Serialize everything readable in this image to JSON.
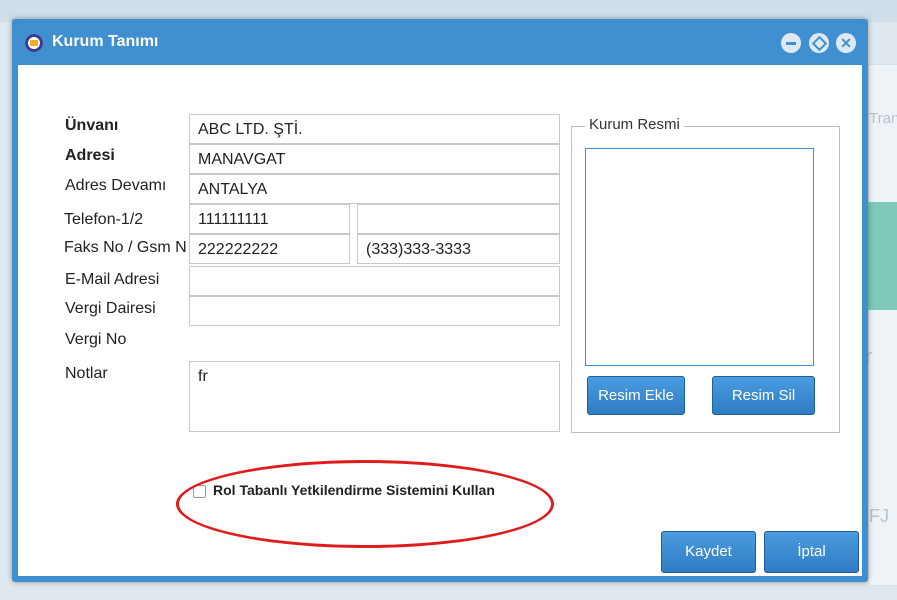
{
  "background": {
    "fragment_tran": "Tran",
    "fragment_fj": "FJ",
    "fragment_r": "r"
  },
  "dialog": {
    "title": "Kurum Tanımı",
    "icons": [
      "app-icon",
      "minimize-icon",
      "maximize-icon",
      "close-icon"
    ]
  },
  "form": {
    "labels": {
      "unvani": "Ünvanı",
      "adresi": "Adresi",
      "adres_devami": "Adres Devamı",
      "telefon": "Telefon-1/2",
      "faks": "Faks No / Gsm N",
      "email": "E-Mail Adresi",
      "vergi_dairesi": "Vergi Dairesi",
      "vergi_no": "Vergi No",
      "notlar": "Notlar"
    },
    "values": {
      "unvani": "ABC LTD. ŞTİ.",
      "adresi": "MANAVGAT",
      "adres_devami": "ANTALYA",
      "telefon1": "111111111",
      "telefon2": "",
      "faks": "222222222",
      "gsm": "(333)333-3333",
      "email": "",
      "vergi_dairesi": "",
      "notlar": "fr"
    }
  },
  "image_group": {
    "legend": "Kurum Resmi",
    "add_button": "Resim Ekle",
    "delete_button": "Resim Sil"
  },
  "checkbox": {
    "label": "Rol Tabanlı Yetkilendirme Sistemini Kullan",
    "checked": false
  },
  "footer": {
    "save": "Kaydet",
    "cancel": "İptal"
  },
  "colors": {
    "accent": "#3f8fd1",
    "highlight_ellipse": "#e01b1b"
  }
}
